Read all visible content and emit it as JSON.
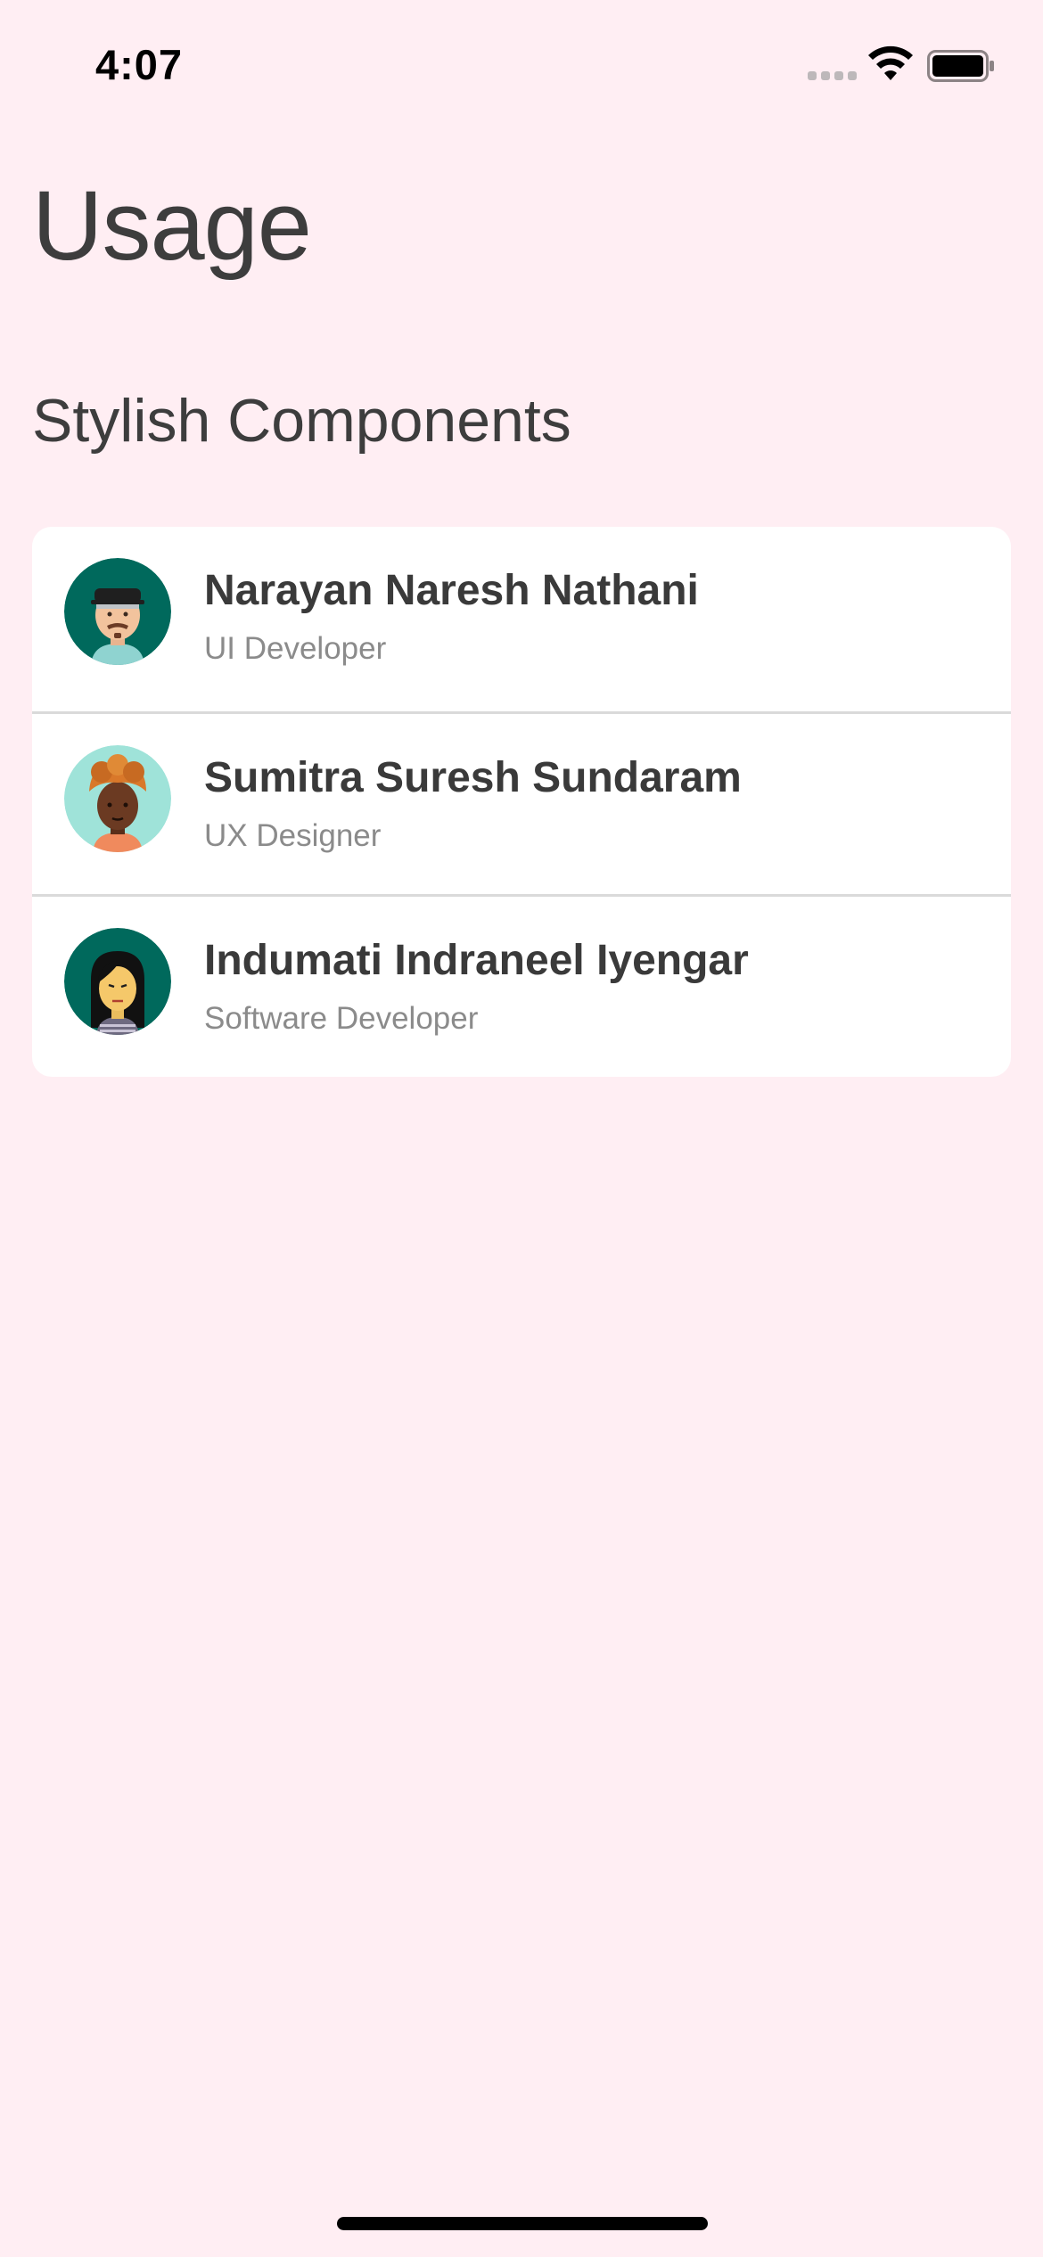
{
  "status_bar": {
    "time": "4:07",
    "icons": [
      "cellular-signal-icon",
      "wifi-icon",
      "battery-icon"
    ]
  },
  "page": {
    "title": "Usage",
    "section_title": "Stylish Components"
  },
  "list": {
    "items": [
      {
        "name": "Narayan Naresh Nathani",
        "role": "UI Developer",
        "avatar": "avatar-man-cap",
        "avatar_bg": "#00695C"
      },
      {
        "name": "Sumitra Suresh Sundaram",
        "role": "UX Designer",
        "avatar": "avatar-woman-turban",
        "avatar_bg": "#9FE3D9"
      },
      {
        "name": "Indumati Indraneel Iyengar",
        "role": "Software Developer",
        "avatar": "avatar-woman-black-hair",
        "avatar_bg": "#00695C"
      }
    ]
  },
  "colors": {
    "background": "#FFEEF3",
    "card": "#FFFFFF",
    "title_text": "#3D3D3D",
    "secondary_text": "#8B8B8B",
    "divider": "#DADADA"
  }
}
